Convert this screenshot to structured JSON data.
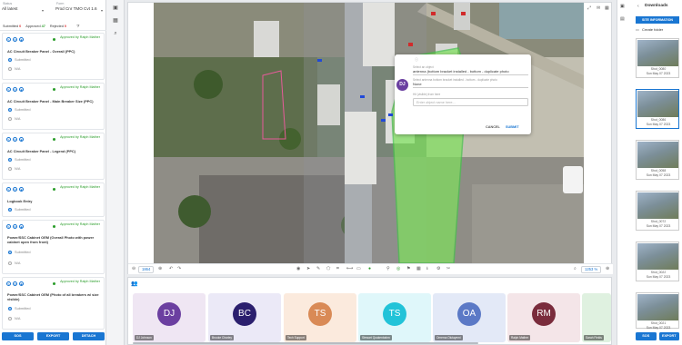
{
  "left": {
    "filter_label": "Status",
    "filter_value": "All latest",
    "form_label": "Form",
    "form_value": "Prod Cnr TMO Cvt 1.6",
    "counts": {
      "submitted_label": "Submitted",
      "submitted": "0",
      "approved_label": "Approved",
      "approved": "47",
      "rejected_label": "Rejected",
      "rejected": "0"
    },
    "cards": [
      {
        "approved": "Approved by Ralph Mather",
        "title": "AC Circuit Breaker Panel - Overall (PPC)",
        "opt1": "Submitted",
        "opt2": "N/A"
      },
      {
        "approved": "Approved by Ralph Mather",
        "title": "AC Circuit Breaker Panel - Main Breaker Size (PPC)",
        "opt1": "Submitted",
        "opt2": "N/A"
      },
      {
        "approved": "Approved by Ralph Mather",
        "title": "AC Circuit Breaker Panel - Legend (PPC)",
        "opt1": "Submitted",
        "opt2": "N/A"
      },
      {
        "approved": "Approved by Ralph Mather",
        "title": "Logbook Entry",
        "opt1": "Submitted"
      },
      {
        "approved": "Approved by Ralph Mather",
        "title": "Power/SSC Cabinet OEM (Overall Photo with power cabinet open from front)",
        "opt1": "Submitted",
        "opt2": "N/A"
      },
      {
        "approved": "Approved by Ralph Mather",
        "title": "Power/SSC Cabinet OEM (Photo of all breakers w/ size visible)",
        "opt1": "Submitted",
        "opt2": "N/A"
      }
    ],
    "buttons": [
      "SOS",
      "EXPORT",
      "DETACH"
    ]
  },
  "viewer": {
    "left_counter": "1864",
    "zoom": "1253 %",
    "popup": {
      "avatar": "DJ",
      "label1": "Select an object",
      "value1": "antenna (bottom bracket installed - bottom - duplicate photo",
      "label2": "Select antenna bottom bracket installed - bottom - duplicate photo",
      "value2": "None",
      "label3": "Hit (visible) from here",
      "placeholder": "Enter object name here...",
      "cancel": "CANCEL",
      "submit": "SUBMIT"
    }
  },
  "people": [
    {
      "initials": "DJ",
      "name": "DJ Johnson",
      "color": "#6b3fa0",
      "bg": "#efe6f3"
    },
    {
      "initials": "BC",
      "name": "Brooke Charley",
      "color": "#2b1f6e",
      "bg": "#ebe9f7"
    },
    {
      "initials": "TS",
      "name": "Tech Support",
      "color": "#d98a56",
      "bg": "#fbeadd"
    },
    {
      "initials": "TS",
      "name": "Stewart Quakenbahm",
      "color": "#22c3d8",
      "bg": "#dff7fa"
    },
    {
      "initials": "OA",
      "name": "Omema Olutayemi",
      "color": "#5b79c6",
      "bg": "#e3e9f7"
    },
    {
      "initials": "RM",
      "name": "Ralph Mather",
      "color": "#7a2c3c",
      "bg": "#f4e5e8"
    },
    {
      "initials": "",
      "name": "Sarah Fields",
      "color": "#2f9c3d",
      "bg": "#dff1e0"
    }
  ],
  "right": {
    "title": "Downloads",
    "site_info": "SITE INFORMATION",
    "create_folder": "Create folder",
    "thumbs": [
      {
        "name": "Shot_0080",
        "date": "Sun May 07 2023"
      },
      {
        "name": "Shot_0086",
        "date": "Sun May 07 2023"
      },
      {
        "name": "Shot_0058",
        "date": "Sun May 07 2023"
      },
      {
        "name": "Shot_0072",
        "date": "Sun May 07 2023"
      },
      {
        "name": "Shot_0022",
        "date": "Sun May 07 2023"
      },
      {
        "name": "Shot_0021",
        "date": "Sun May 07 2023"
      }
    ],
    "buttons": [
      "SOS",
      "EXPORT"
    ]
  },
  "colors": {
    "accent": "#1976d2",
    "approved": "#2a9d2a",
    "selection": "#7ee25c"
  }
}
